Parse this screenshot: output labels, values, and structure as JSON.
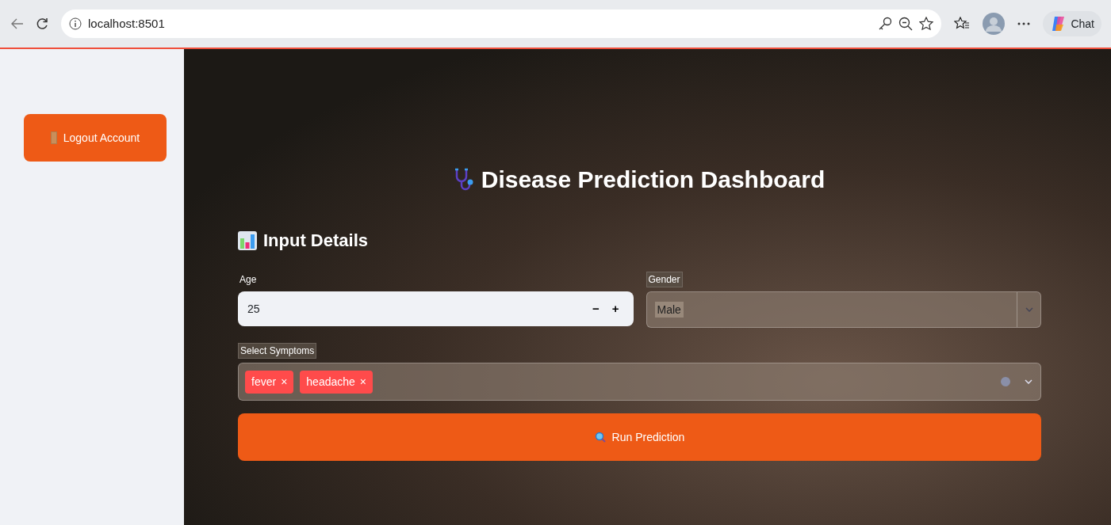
{
  "browser": {
    "url": "localhost:8501",
    "chat_label": "Chat"
  },
  "sidebar": {
    "logout_button": "Logout Account"
  },
  "main": {
    "title": "Disease Prediction Dashboard",
    "section_title": "Input Details",
    "age": {
      "label": "Age",
      "value": "25",
      "decrement": "−",
      "increment": "+"
    },
    "gender": {
      "label": "Gender",
      "value": "Male"
    },
    "symptoms": {
      "label": "Select Symptoms",
      "tags": [
        {
          "label": "fever",
          "remove": "×"
        },
        {
          "label": "headache",
          "remove": "×"
        }
      ]
    },
    "run_button": "Run Prediction"
  }
}
